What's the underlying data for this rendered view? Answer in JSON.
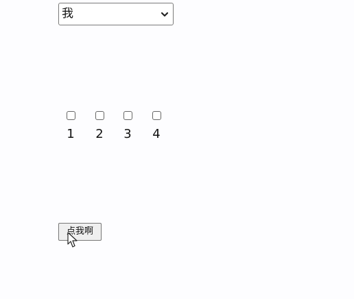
{
  "select": {
    "selected": "我"
  },
  "checkbox_group": {
    "items": [
      {
        "label": "1",
        "checked": false
      },
      {
        "label": "2",
        "checked": false
      },
      {
        "label": "3",
        "checked": false
      },
      {
        "label": "4",
        "checked": false
      }
    ]
  },
  "action_button": {
    "label": "点我啊"
  },
  "icons": {
    "dropdown": "chevron-down-icon",
    "pointer": "mouse-pointer-icon"
  },
  "colors": {
    "background": "#fdfdff",
    "border": "#7a7a7a",
    "button_background": "#efefef"
  }
}
